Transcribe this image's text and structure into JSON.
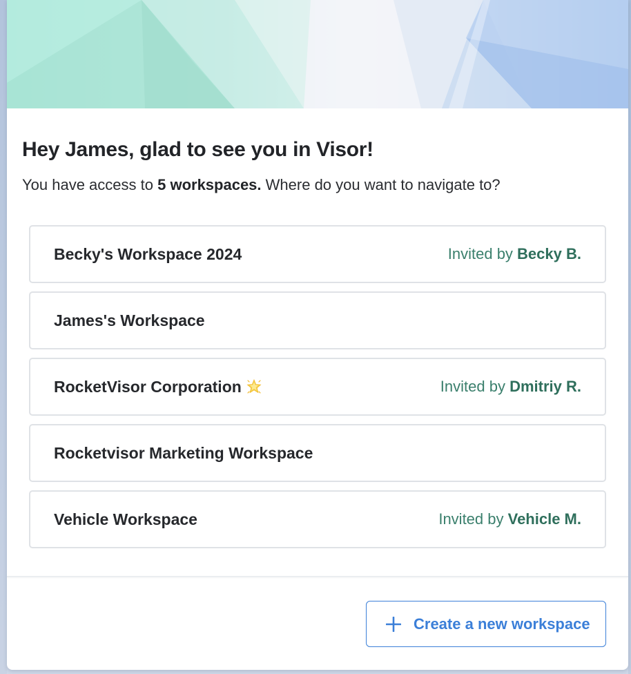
{
  "greeting": "Hey James, glad to see you in Visor!",
  "subtitle": {
    "prefix": "You have access to ",
    "count_text": "5 workspaces.",
    "suffix": " Where do you want to navigate to?"
  },
  "workspaces": [
    {
      "name": "Becky's Workspace 2024",
      "invited_prefix": "Invited by ",
      "inviter": "Becky B."
    },
    {
      "name": "James's Workspace",
      "invited_prefix": "",
      "inviter": ""
    },
    {
      "name": "RocketVisor Corporation",
      "icon": "sparkle-star-icon",
      "invited_prefix": "Invited by ",
      "inviter": "Dmitriy R."
    },
    {
      "name": "Rocketvisor Marketing Workspace",
      "invited_prefix": "",
      "inviter": ""
    },
    {
      "name": "Vehicle Workspace",
      "invited_prefix": "Invited by ",
      "inviter": "Vehicle M."
    }
  ],
  "footer": {
    "create_button_label": "Create a new workspace",
    "create_button_icon": "plus-icon"
  },
  "colors": {
    "accent_blue": "#3b7fd8",
    "invite_green": "#3a7f6c",
    "text_dark": "#222428",
    "border": "#dfe2e6"
  }
}
